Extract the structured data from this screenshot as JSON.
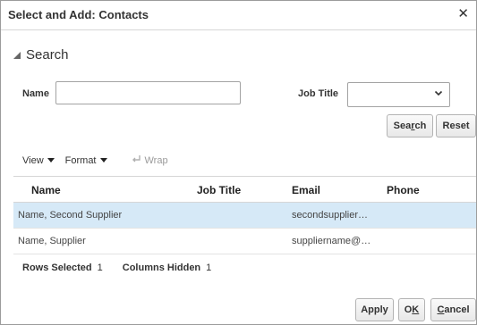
{
  "dialog": {
    "title": "Select and Add: Contacts",
    "close_glyph": "✕"
  },
  "search": {
    "heading": "Search",
    "name_label": "Name",
    "name_value": "",
    "job_title_label": "Job Title",
    "job_title_value": "",
    "search_button": {
      "pre": "Sea",
      "accel": "r",
      "post": "ch"
    },
    "reset_button": "Reset"
  },
  "toolbar": {
    "view_label": "View",
    "format_label": "Format",
    "wrap_label": "Wrap"
  },
  "table": {
    "columns": [
      "Name",
      "Job Title",
      "Email",
      "Phone"
    ],
    "rows": [
      {
        "name": "Name, Second Supplier",
        "job_title": "",
        "email": "secondsupplier…",
        "phone": "",
        "selected": true
      },
      {
        "name": "Name, Supplier",
        "job_title": "",
        "email": "suppliername@…",
        "phone": "",
        "selected": false
      }
    ]
  },
  "status": {
    "rows_selected_label": "Rows Selected",
    "rows_selected_value": "1",
    "columns_hidden_label": "Columns Hidden",
    "columns_hidden_value": "1"
  },
  "footer": {
    "apply_button": "Apply",
    "ok_button": {
      "pre": "O",
      "accel": "K",
      "post": ""
    },
    "cancel_button": {
      "pre": "",
      "accel": "C",
      "post": "ancel"
    }
  },
  "colors": {
    "selected_row": "#d6e9f7",
    "border": "#a3a3a3"
  }
}
